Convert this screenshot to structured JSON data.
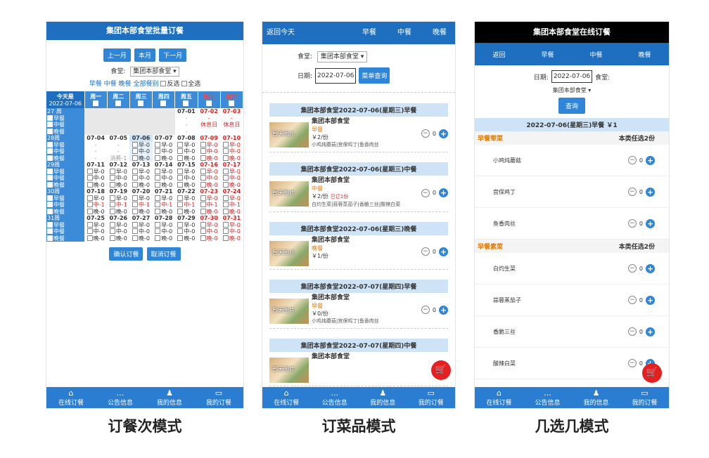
{
  "captions": [
    "订餐次模式",
    "订菜品模式",
    "几选几模式"
  ],
  "tabs": [
    "在线订餐",
    "公告信息",
    "我的信息",
    "我的订餐"
  ],
  "p1": {
    "title": "集团本部食堂批量订餐",
    "nav": [
      "上一月",
      "本月",
      "下一月"
    ],
    "canteen_label": "食堂:",
    "canteen_value": "集团本部食堂",
    "filters": [
      "早餐",
      "中餐",
      "晚餐",
      "全部餐别"
    ],
    "reverse": "反选",
    "all": "全选",
    "today_label": "今天是",
    "today_date": "2022-07-06",
    "weekdays": [
      "周一",
      "周二",
      "周三",
      "周四",
      "周五",
      "周六",
      "周日"
    ],
    "meals": [
      "早餐",
      "中餐",
      "晚餐"
    ],
    "weeks": [
      {
        "label": "27 周",
        "dates": [
          "",
          "",
          "",
          "",
          "07-01",
          "07-02",
          "07-03"
        ],
        "rows": [
          [
            "",
            "",
            "",
            "",
            "-",
            "-",
            "-"
          ],
          [
            "",
            "",
            "",
            "",
            "-",
            "休息日",
            "休息日"
          ],
          [
            "",
            "",
            "",
            "",
            "-",
            "",
            ""
          ]
        ]
      },
      {
        "label": "28周",
        "dates": [
          "07-04",
          "07-05",
          "07-06",
          "07-07",
          "07-08",
          "07-09",
          "07-10"
        ],
        "rows": [
          [
            "-",
            "-",
            "早-0",
            "早-0",
            "早-0",
            "早-0",
            "早-0"
          ],
          [
            "-",
            "-",
            "中-0",
            "中-0",
            "中-0",
            "中-0",
            "中-0"
          ],
          [
            "-",
            "消费-1",
            "晚-0",
            "晚-0",
            "晚-0",
            "晚-0",
            "晚-0"
          ]
        ]
      },
      {
        "label": "29周",
        "dates": [
          "07-11",
          "07-12",
          "07-13",
          "07-14",
          "07-15",
          "07-16",
          "07-17"
        ],
        "rows": [
          [
            "早-0",
            "早-0",
            "早-0",
            "早-0",
            "早-0",
            "早-0",
            "早-0"
          ],
          [
            "中-0",
            "中-0",
            "中-0",
            "中-0",
            "中-0",
            "中-0",
            "中-0"
          ],
          [
            "晚-0",
            "晚-0",
            "晚-0",
            "晚-0",
            "晚-0",
            "晚-0",
            "晚-0"
          ]
        ]
      },
      {
        "label": "30周",
        "dates": [
          "07-18",
          "07-19",
          "07-20",
          "07-21",
          "07-22",
          "07-23",
          "07-24"
        ],
        "rows": [
          [
            "早-0",
            "早-0",
            "早-0",
            "早-0",
            "早-0",
            "早-0",
            "早-0"
          ],
          [
            "中-1",
            "中-1",
            "中-1",
            "中-1",
            "中-1",
            "中-1",
            "中-1"
          ],
          [
            "晚-0",
            "晚-0",
            "晚-0",
            "晚-0",
            "晚-0",
            "晚-0",
            "晚-0"
          ]
        ]
      },
      {
        "label": "31周",
        "dates": [
          "07-25",
          "07-26",
          "07-27",
          "07-28",
          "07-29",
          "07-30",
          "07-31"
        ],
        "rows": [
          [
            "早-0",
            "早-0",
            "早-0",
            "早-0",
            "早-0",
            "早-0",
            "早-0"
          ],
          [
            "中-0",
            "中-0",
            "中-0",
            "中-0",
            "中-0",
            "中-0",
            "中-0"
          ],
          [
            "晚-0",
            "晚-0",
            "晚-0",
            "晚-0",
            "晚-0",
            "晚-0",
            "晚-0"
          ]
        ]
      }
    ],
    "confirm": "确认订餐",
    "cancel": "取消订餐"
  },
  "p2": {
    "back": "返回今天",
    "meals": [
      "早餐",
      "中餐",
      "晚餐"
    ],
    "canteen_label": "食堂:",
    "canteen_value": "集团本部食堂",
    "date_label": "日期:",
    "date_value": "2022-07-06",
    "query": "菜单查询",
    "cards": [
      {
        "title": "集团本部食堂2022-07-06(星期三)早餐",
        "name": "集团本部食堂",
        "meal": "早餐",
        "price": "￥2/份",
        "ordered": "",
        "desc": "小鸡炖蘑菇|宫保鸡丁|鱼香肉丝",
        "qty": "0"
      },
      {
        "title": "集团本部食堂2022-07-06(星期三)中餐",
        "name": "集团本部食堂",
        "meal": "中餐",
        "price": "￥2/份",
        "ordered": "已订1份",
        "desc": "白灼生菜|蒜蓉蒸茄子|香脆三丝|酸辣白菜",
        "qty": "0"
      },
      {
        "title": "集团本部食堂2022-07-06(星期三)晚餐",
        "name": "集团本部食堂",
        "meal": "晚餐",
        "price": "￥1/份",
        "ordered": "",
        "desc": "",
        "qty": "0"
      },
      {
        "title": "集团本部食堂2022-07-07(星期四)早餐",
        "name": "集团本部食堂",
        "meal": "早餐",
        "price": "￥0/份",
        "ordered": "",
        "desc": "小鸡炖蘑菇|宫保鸡丁|鱼香肉丝",
        "qty": "0"
      },
      {
        "title": "集团本部食堂2022-07-07(星期四)中餐",
        "name": "集团本部食堂",
        "meal": "",
        "price": "",
        "ordered": "",
        "desc": "",
        "qty": ""
      }
    ],
    "no_image": "暂无图片"
  },
  "p3": {
    "title": "集团本部食堂在线订餐",
    "nav": [
      "返回",
      "早餐",
      "中餐",
      "晚餐"
    ],
    "date_label": "日期:",
    "date_value": "2022-07-06",
    "canteen_label": "食堂:",
    "canteen_value": "集团本部食堂",
    "query": "查询",
    "header": "2022-07-06(星期三)早餐 ￥1",
    "groups": [
      {
        "name": "早餐荤菜",
        "rule": "本类任选2份",
        "items": [
          "小鸡炖蘑菇",
          "宫保鸡丁",
          "鱼香肉丝"
        ]
      },
      {
        "name": "早餐素菜",
        "rule": "本类任选2份",
        "items": [
          "白灼生菜",
          "蒜蓉蒸茄子",
          "香脆三丝",
          "酸辣白菜"
        ]
      }
    ],
    "qty": "0"
  },
  "icons": {
    "cart": "cart-icon",
    "home": "home-icon",
    "notice": "chat-icon",
    "user": "user-icon",
    "order": "message-icon"
  }
}
